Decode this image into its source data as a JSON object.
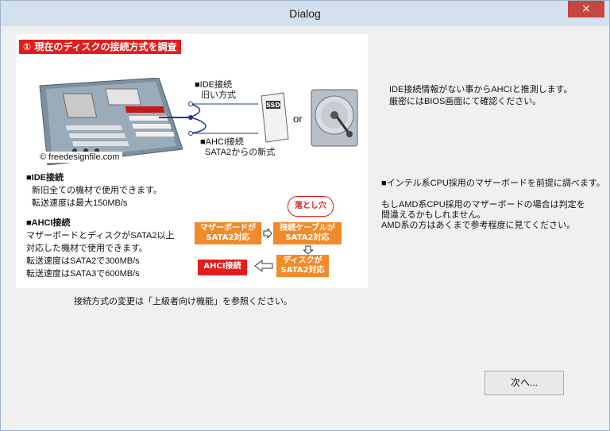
{
  "window": {
    "title": "Dialog",
    "close_label": "×"
  },
  "image_panel": {
    "heading": "① 現在のディスクの接続方式を調査",
    "copyright": "© freedesignfile.com",
    "ide_label_line1": "■IDE接続",
    "ide_label_line2": "旧い方式",
    "ahci_label_line1": "■AHCI接続",
    "ahci_label_line2": "SATA2からの新式",
    "ssd_label": "SSD",
    "or_label": "or",
    "ide_desc": {
      "title": "■IDE接続",
      "lines": [
        "新旧全ての機材で使用できます。",
        "転送速度は最大150MB/s"
      ]
    },
    "ahci_desc": {
      "title": "■AHCI接続",
      "lines": [
        "マザーボードとディスクがSATA2以上",
        "対応した機材で使用できます。",
        "転送速度はSATA2で300MB/s",
        "転送速度はSATA3で600MB/s"
      ]
    },
    "flow": {
      "pitfall": "落とし穴",
      "mb_support": [
        "マザーボードが",
        "SATA2対応"
      ],
      "cable_support": [
        "接続ケーブルが",
        "SATA2対応"
      ],
      "disk_support": [
        "ディスクが",
        "SATA2対応"
      ],
      "result": "AHCI接続"
    }
  },
  "bottom_note": "接続方式の変更は「上級者向け機能」を参照ください。",
  "right_info": {
    "para1": [
      "IDE接続情報がない事からAHCIと推測します。",
      "厳密にはBIOS画面にて確認ください。"
    ],
    "para2": "■インテル系CPU採用のマザーボードを前提に調べます。",
    "para3": [
      "もしAMD系CPU採用のマザーボードの場合は判定を",
      "間違えるかもしれません。",
      "AMD系の方はあくまで参考程度に見てください。"
    ]
  },
  "buttons": {
    "next": "次へ..."
  },
  "colors": {
    "accent_red": "#e31d1d",
    "accent_orange": "#f28a2a",
    "titlebar": "#d3e0ee",
    "close": "#c7463f"
  },
  "icons": [
    "close-icon",
    "motherboard-icon",
    "ssd-icon",
    "hdd-icon",
    "right-arrow-icon",
    "down-arrow-icon",
    "left-arrow-icon"
  ]
}
